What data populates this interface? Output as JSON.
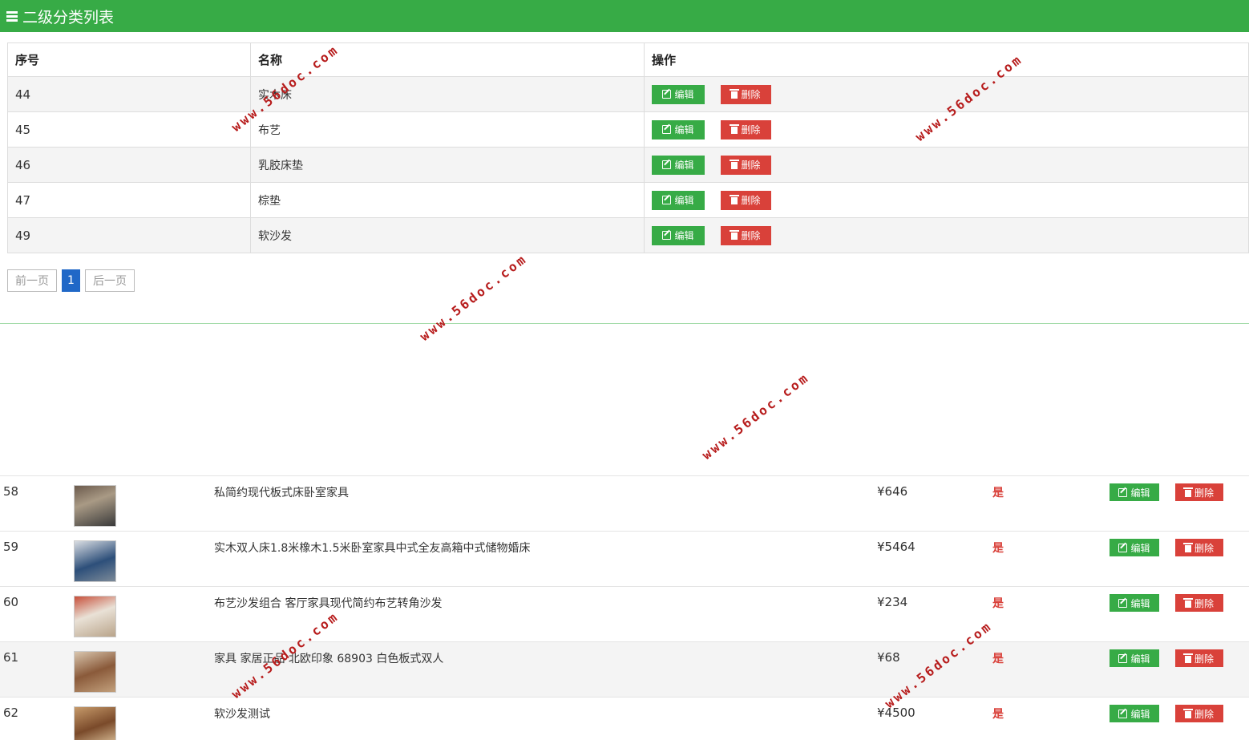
{
  "header": {
    "title": "二级分类列表"
  },
  "table": {
    "columns": [
      "序号",
      "名称",
      "操作"
    ],
    "rows": [
      {
        "id": "44",
        "name": "实木床"
      },
      {
        "id": "45",
        "name": "布艺"
      },
      {
        "id": "46",
        "name": "乳胶床垫"
      },
      {
        "id": "47",
        "name": "棕垫"
      },
      {
        "id": "49",
        "name": "软沙发"
      }
    ],
    "edit_label": "编辑",
    "delete_label": "删除"
  },
  "pagination": {
    "prev": "前一页",
    "current": "1",
    "next": "后一页"
  },
  "products": [
    {
      "id": "58",
      "name": "私简约现代板式床卧室家具",
      "price": "¥646",
      "recommend": "是"
    },
    {
      "id": "59",
      "name": "实木双人床1.8米橡木1.5米卧室家具中式全友高箱中式储物婚床",
      "price": "¥5464",
      "recommend": "是"
    },
    {
      "id": "60",
      "name": "布艺沙发组合 客厅家具现代简约布艺转角沙发",
      "price": "¥234",
      "recommend": "是"
    },
    {
      "id": "61",
      "name": "家具 家居正品 北欧印象 68903 白色板式双人",
      "price": "¥68",
      "recommend": "是"
    },
    {
      "id": "62",
      "name": "软沙发测试",
      "price": "¥4500",
      "recommend": "是"
    }
  ],
  "product_actions": {
    "edit_label": "编辑",
    "delete_label": "删除"
  },
  "watermark": "www.56doc.com",
  "colors": {
    "header": "#37ab46",
    "edit": "#37ab46",
    "delete": "#d9413a",
    "pager_active": "#2068c7"
  }
}
